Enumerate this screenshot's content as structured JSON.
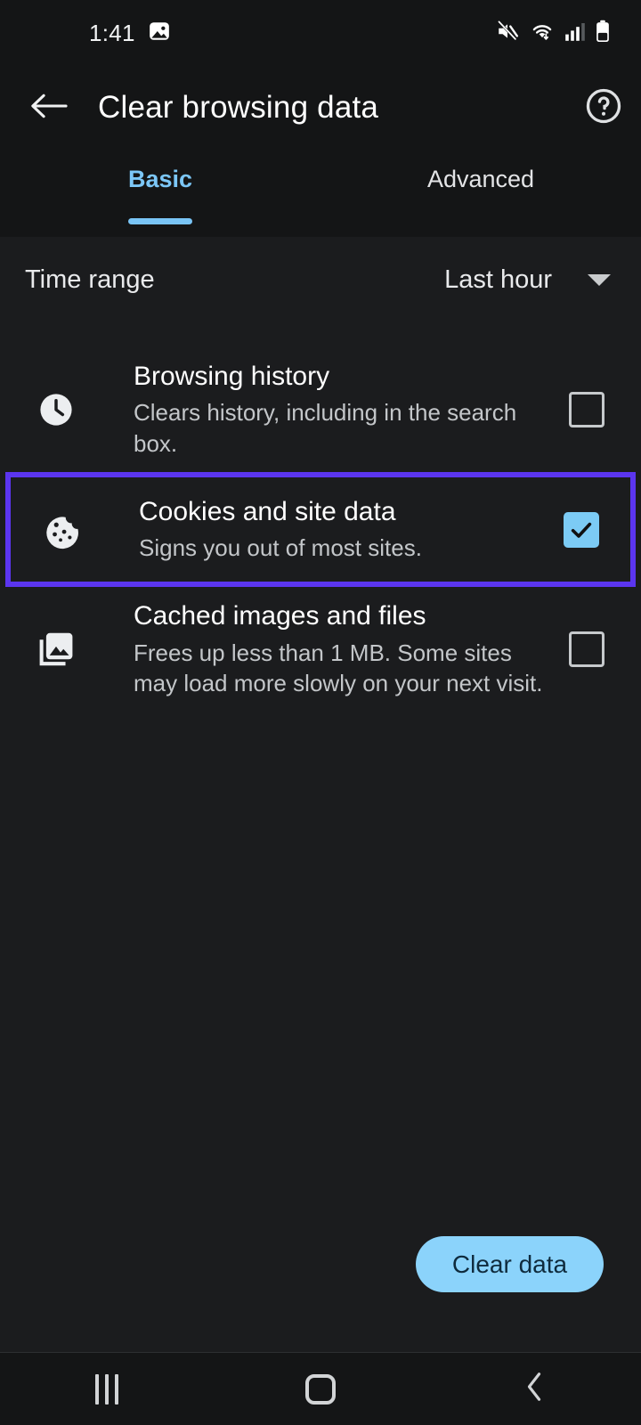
{
  "status_bar": {
    "time": "1:41",
    "left_icons": [
      "image-icon"
    ],
    "right_icons": [
      "mute-icon",
      "wifi-icon",
      "cellular-signal-icon",
      "battery-icon"
    ]
  },
  "app_bar": {
    "back_icon": "back-arrow-icon",
    "title": "Clear browsing data",
    "help_icon": "help-circle-icon"
  },
  "tabs": [
    {
      "label": "Basic",
      "active": true
    },
    {
      "label": "Advanced",
      "active": false
    }
  ],
  "time_range": {
    "label": "Time range",
    "value": "Last hour",
    "caret_icon": "chevron-down-icon"
  },
  "rows": [
    {
      "icon": "clock-icon",
      "title": "Browsing history",
      "description": "Clears history, including in the search box.",
      "checked": false,
      "highlighted": false
    },
    {
      "icon": "cookie-icon",
      "title": "Cookies and site data",
      "description": "Signs you out of most sites.",
      "checked": true,
      "highlighted": true
    },
    {
      "icon": "images-icon",
      "title": "Cached images and files",
      "description": "Frees up less than 1 MB. Some sites may load more slowly on your next visit.",
      "checked": false,
      "highlighted": false
    }
  ],
  "primary_action": {
    "label": "Clear data"
  },
  "nav_bar": {
    "recents_label": "recents-icon",
    "home_label": "home-icon",
    "back_label": "back-chevron-icon"
  },
  "colors": {
    "background": "#1b1c1e",
    "surface": "#141516",
    "accent_blue": "#7cc7f7",
    "checkbox_checked": "#7ccbf5",
    "button_blue": "#8bd3fb",
    "highlight_purple": "#5b35ef",
    "text_primary": "#ffffff",
    "text_secondary": "#c3c6c9"
  }
}
